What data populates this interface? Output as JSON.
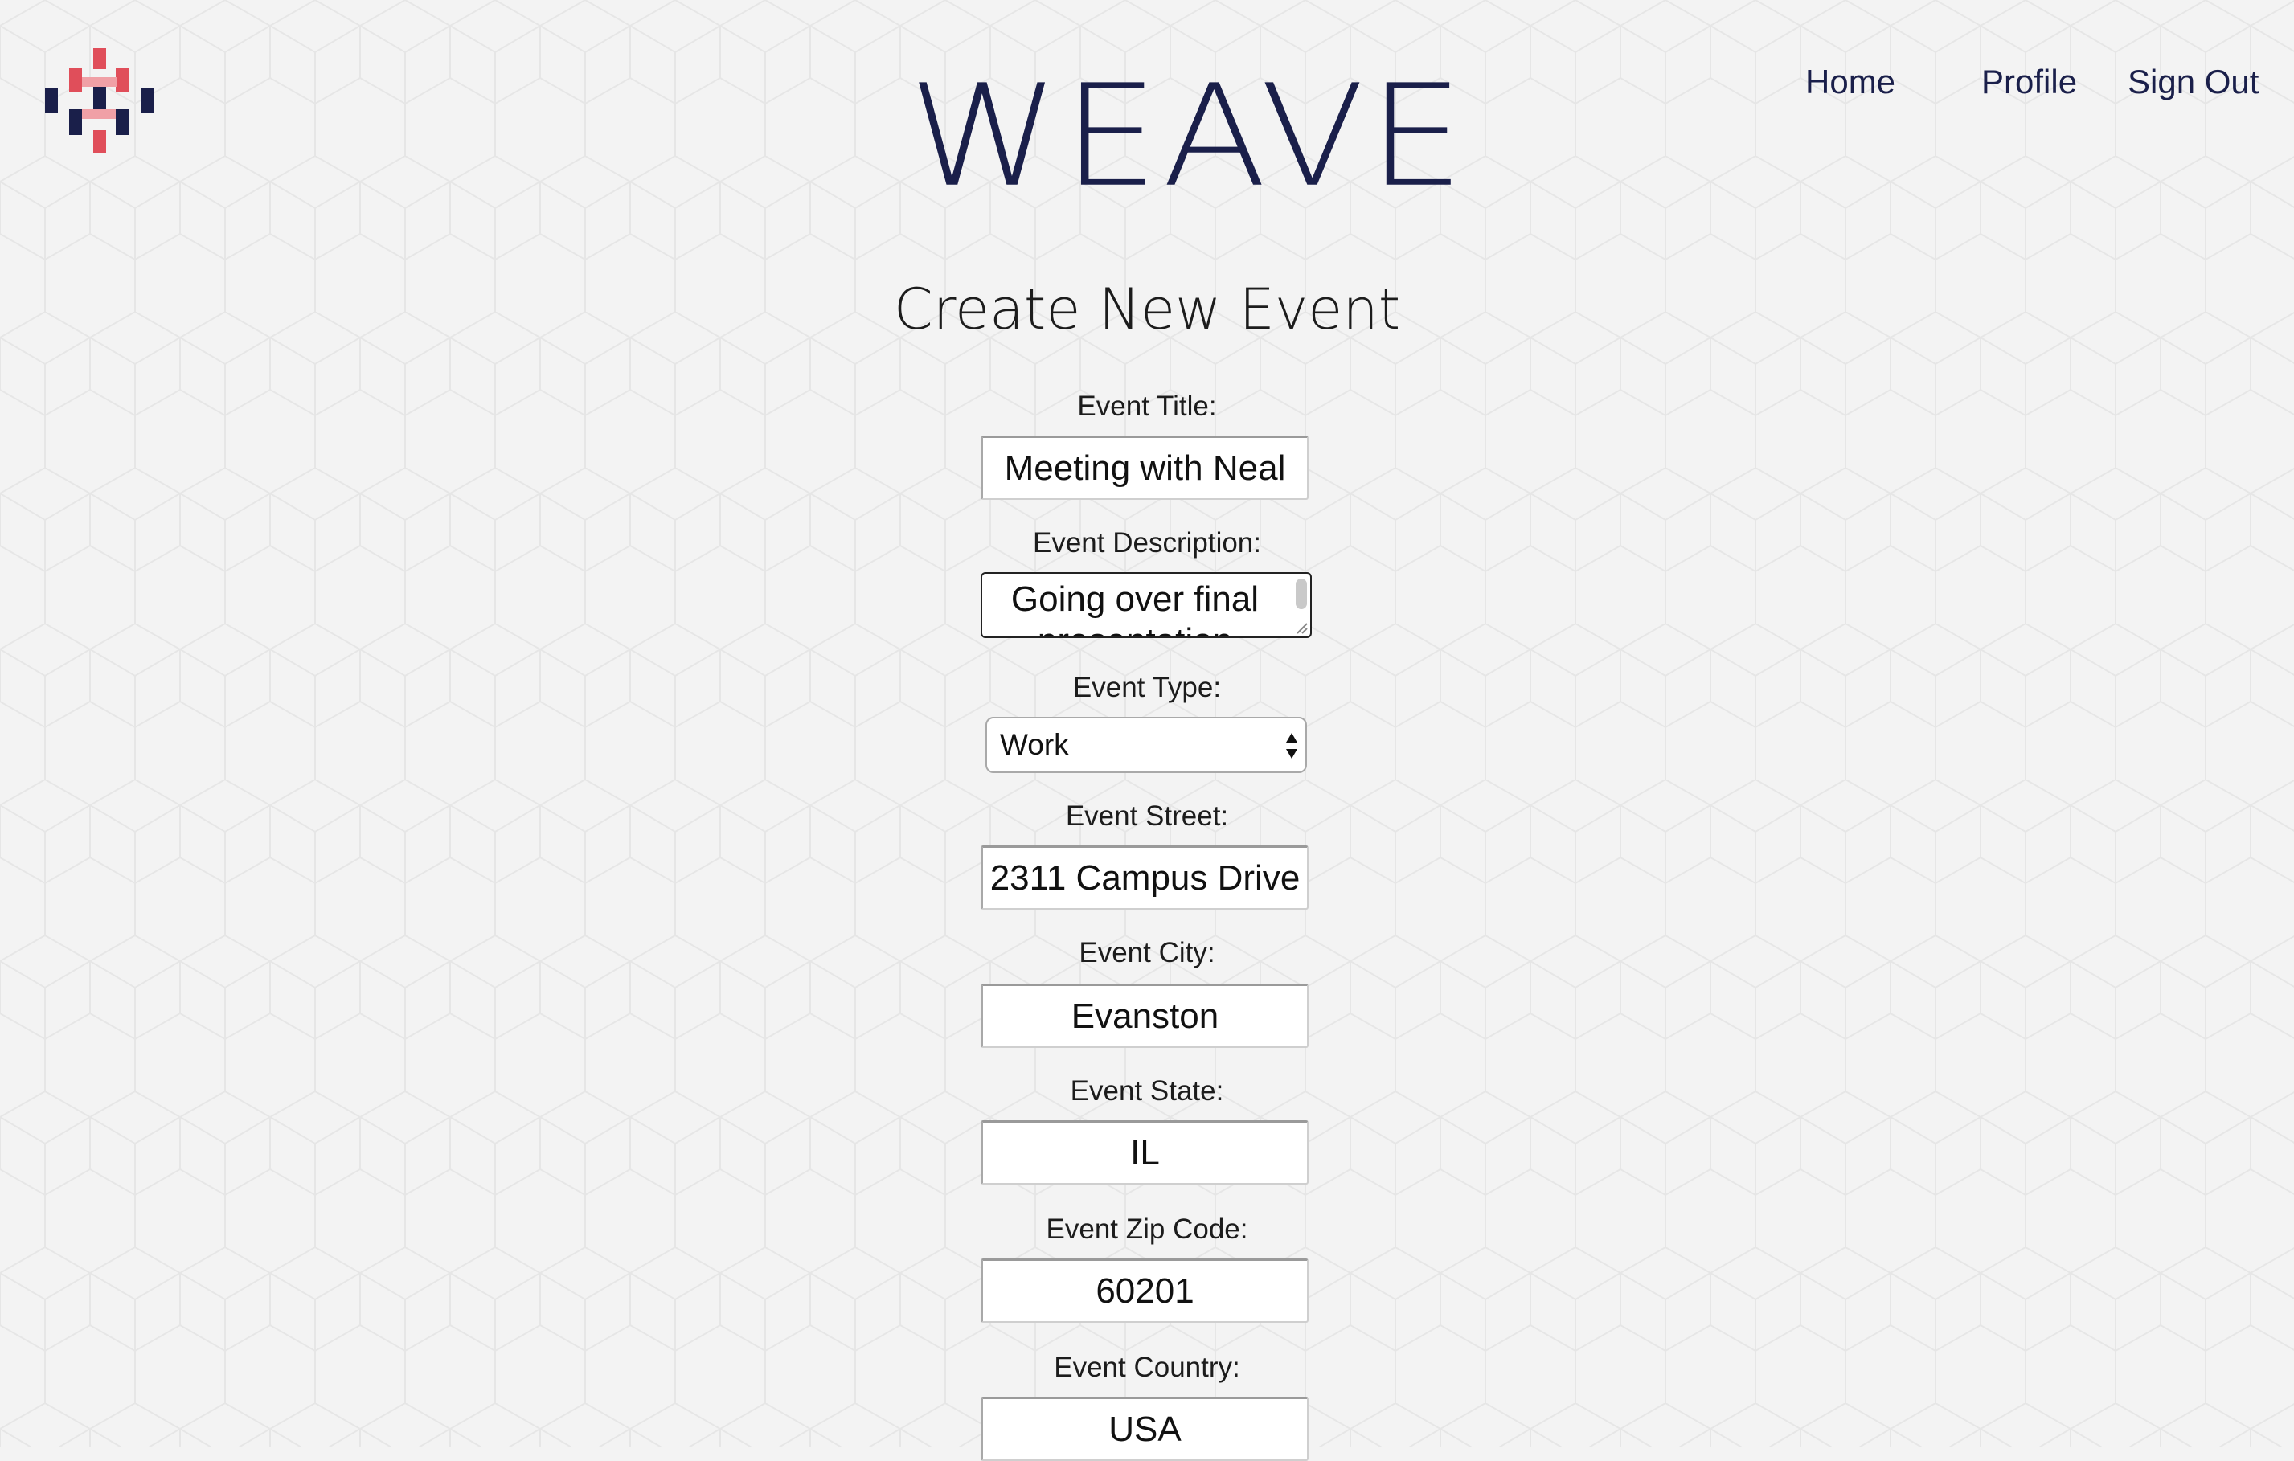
{
  "brand": {
    "logo_icon": "weave-logo-icon",
    "name": "WEAVE"
  },
  "nav": {
    "home": "Home",
    "profile": "Profile",
    "sign_out": "Sign Out"
  },
  "page": {
    "title": "Create New Event"
  },
  "form": {
    "title_label": "Event Title:",
    "title_value": "Meeting with Neal",
    "description_label": "Event Description:",
    "description_value": "Going over final presentation",
    "type_label": "Event Type:",
    "type_value": "Work",
    "street_label": "Event Street:",
    "street_value": "2311 Campus Drive",
    "city_label": "Event City:",
    "city_value": "Evanston",
    "state_label": "Event State:",
    "state_value": "IL",
    "zip_label": "Event Zip Code:",
    "zip_value": "60201",
    "country_label": "Event Country:",
    "country_value": "USA"
  },
  "colors": {
    "brand_navy": "#1a1f4a",
    "logo_red": "#e04e5a",
    "logo_navy": "#1a1f4a",
    "background": "#f3f3f3"
  }
}
